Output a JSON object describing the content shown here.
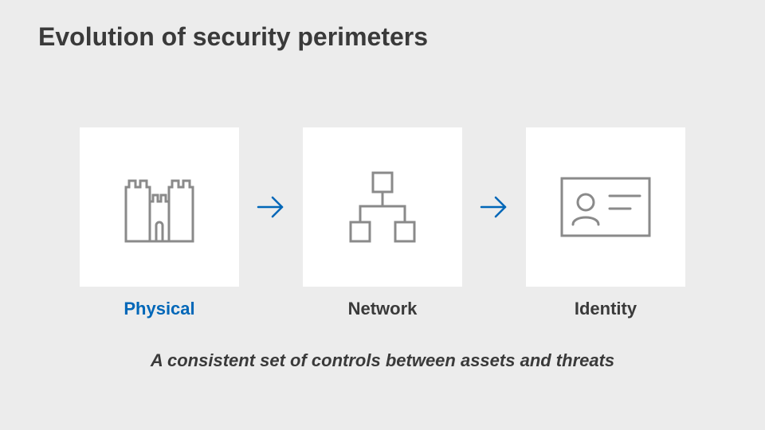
{
  "title": "Evolution of security perimeters",
  "stages": {
    "physical": {
      "label": "Physical",
      "icon": "castle-icon"
    },
    "network": {
      "label": "Network",
      "icon": "network-icon"
    },
    "identity": {
      "label": "Identity",
      "icon": "id-card-icon"
    }
  },
  "arrow_glyph": "→",
  "tagline": "A consistent set of controls between assets and threats",
  "colors": {
    "background": "#ececec",
    "card": "#ffffff",
    "text": "#3a3a3a",
    "accent": "#0067b8",
    "icon_stroke": "#8a8a8a"
  }
}
